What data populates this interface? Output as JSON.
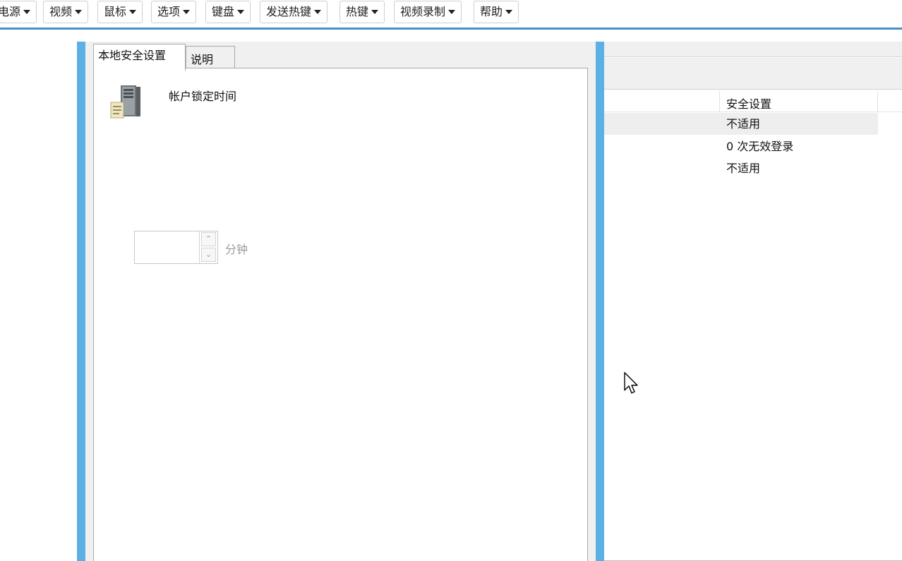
{
  "toolbar": {
    "menus": [
      {
        "label": "电源"
      },
      {
        "label": "视频"
      },
      {
        "label": "鼠标"
      },
      {
        "label": "选项"
      },
      {
        "label": "键盘"
      },
      {
        "label": "发送热键"
      },
      {
        "label": "热键"
      },
      {
        "label": "视频录制"
      },
      {
        "label": "帮助"
      }
    ]
  },
  "dialog": {
    "tabs": [
      {
        "label": "本地安全设置",
        "active": true
      },
      {
        "label": "说明",
        "active": false
      }
    ],
    "policy_title": "帐户锁定时间",
    "duration_value": "",
    "duration_unit": "分钟",
    "icon": "server-icon"
  },
  "policy_list": {
    "column_header": "安全设置",
    "rows": [
      {
        "value": "不适用",
        "selected": true
      },
      {
        "value": "0 次无效登录",
        "selected": false
      },
      {
        "value": "不适用",
        "selected": false
      }
    ]
  },
  "colors": {
    "accent_blue": "#5db0e4",
    "toolbar_underline": "#4a8fc6"
  }
}
